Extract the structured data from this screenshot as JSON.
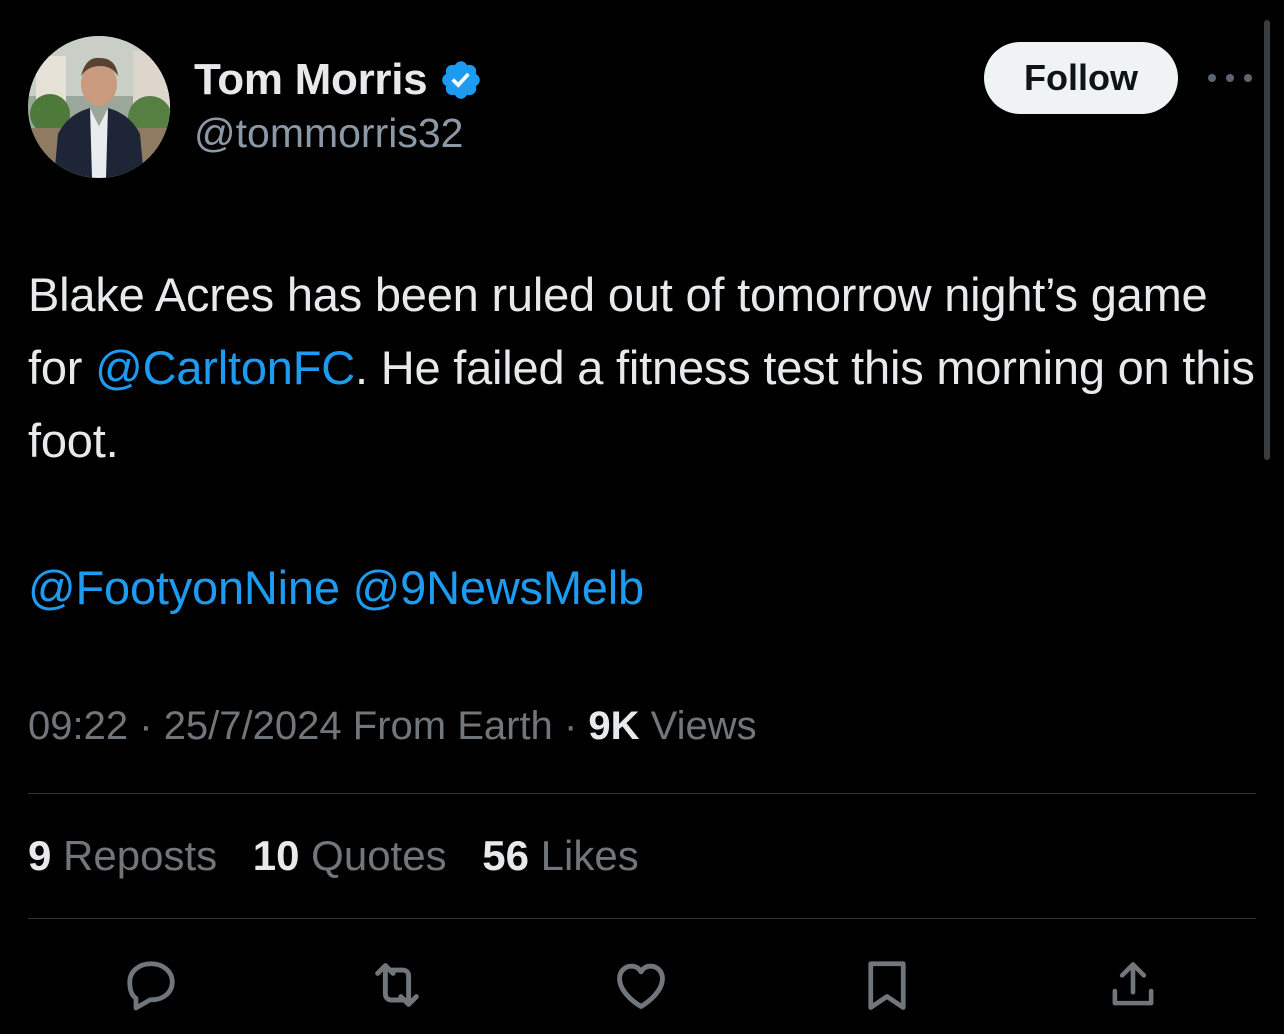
{
  "author": {
    "display_name": "Tom Morris",
    "handle": "@tommorris32",
    "verified": true
  },
  "follow_label": "Follow",
  "tweet": {
    "text_parts": [
      "Blake Acres has been ruled out of tomorrow night’s game for ",
      "@CarltonFC",
      ". He failed a fitness test this morning on this foot."
    ],
    "tags": [
      "@FootyonNine",
      "@9NewsMelb"
    ]
  },
  "meta": {
    "time": "09:22",
    "date": "25/7/2024",
    "source": "From Earth",
    "views_count": "9K",
    "views_label": "Views",
    "separator": "·"
  },
  "stats": {
    "reposts_count": "9",
    "reposts_label": "Reposts",
    "quotes_count": "10",
    "quotes_label": "Quotes",
    "likes_count": "56",
    "likes_label": "Likes"
  },
  "actions": [
    "reply-icon",
    "repost-icon",
    "like-icon",
    "bookmark-icon",
    "share-icon"
  ],
  "colors": {
    "background": "#000000",
    "accent": "#1d9bf0",
    "text_primary": "#e7e9ea",
    "text_secondary": "#71767b",
    "divider": "#2f3336",
    "follow_button_bg": "#eff3f4"
  }
}
